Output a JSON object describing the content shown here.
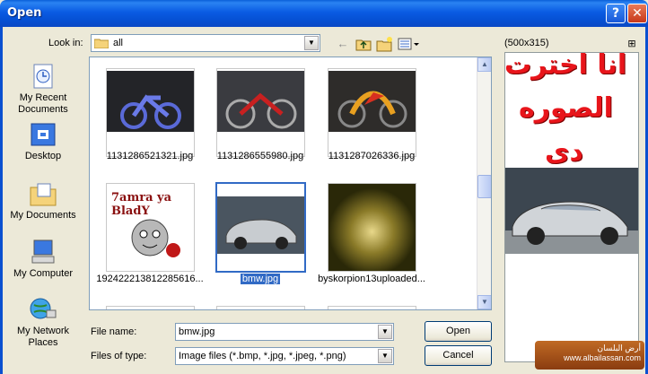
{
  "window": {
    "title": "Open",
    "help_label": "?",
    "close_label": "✕"
  },
  "look_in": {
    "label": "Look in:",
    "value": "all"
  },
  "preview": {
    "dimensions": "(500x315)",
    "caption_lines": [
      "انا اخترت",
      "الصوره",
      "دى"
    ]
  },
  "places": [
    {
      "label": "My Recent Documents",
      "icon": "recent-documents-icon"
    },
    {
      "label": "Desktop",
      "icon": "desktop-icon"
    },
    {
      "label": "My Documents",
      "icon": "my-documents-icon"
    },
    {
      "label": "My Computer",
      "icon": "my-computer-icon"
    },
    {
      "label": "My Network Places",
      "icon": "network-places-icon"
    }
  ],
  "files": [
    {
      "name": "1131286521321.jpg",
      "selected": false
    },
    {
      "name": "1131286555980.jpg",
      "selected": false
    },
    {
      "name": "1131287026336.jpg",
      "selected": false
    },
    {
      "name": "192422213812285616...",
      "selected": false,
      "thumb_text": "7amra ya BladY"
    },
    {
      "name": "bmw.jpg",
      "selected": true
    },
    {
      "name": "byskorpion13uploaded...",
      "selected": false
    }
  ],
  "file_name": {
    "label": "File name:",
    "value": "bmw.jpg"
  },
  "file_type": {
    "label": "Files of type:",
    "value": "Image files (*.bmp, *.jpg, *.jpeg, *.png)"
  },
  "buttons": {
    "open": "Open",
    "cancel": "Cancel"
  },
  "watermark": {
    "line1": "أرض البلسان",
    "line2": "www.albailassan.com"
  }
}
